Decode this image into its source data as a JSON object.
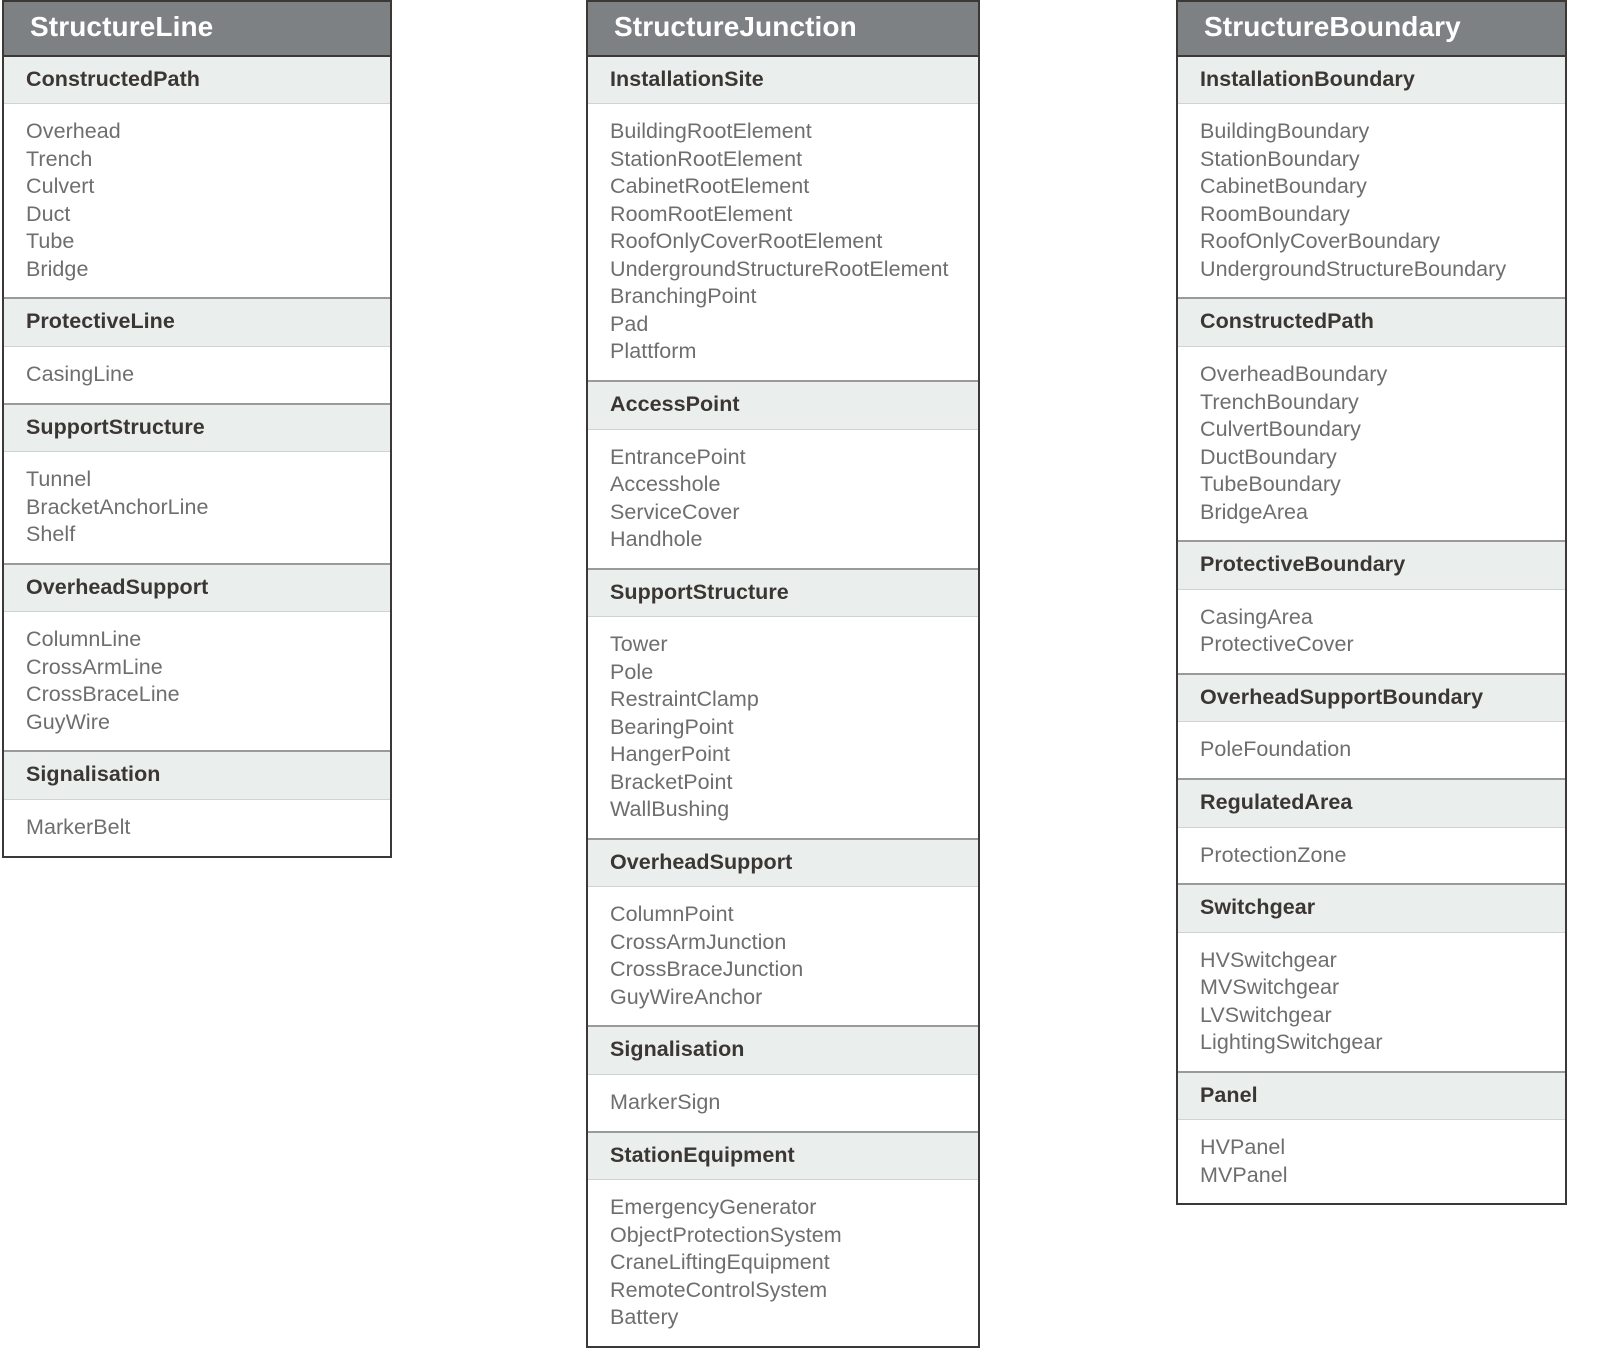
{
  "colors": {
    "title_bar_bg": "#7d8184",
    "title_bar_text": "#ffffff",
    "section_header_bg": "#eaeeed",
    "section_header_text": "#3b3633",
    "item_text": "#6e6e6e",
    "card_border": "#3b3836",
    "section_divider": "#9a9a98",
    "page_bg": "#ffffff"
  },
  "tables": [
    {
      "title": "StructureLine",
      "sections": [
        {
          "name": "ConstructedPath",
          "items": [
            "Overhead",
            "Trench",
            "Culvert",
            "Duct",
            "Tube",
            "Bridge"
          ]
        },
        {
          "name": "ProtectiveLine",
          "items": [
            "CasingLine"
          ]
        },
        {
          "name": "SupportStructure",
          "items": [
            "Tunnel",
            "BracketAnchorLine",
            "Shelf"
          ]
        },
        {
          "name": "OverheadSupport",
          "items": [
            "ColumnLine",
            "CrossArmLine",
            "CrossBraceLine",
            "GuyWire"
          ]
        },
        {
          "name": "Signalisation",
          "items": [
            "MarkerBelt"
          ]
        }
      ]
    },
    {
      "title": "StructureJunction",
      "sections": [
        {
          "name": "InstallationSite",
          "items": [
            "BuildingRootElement",
            "StationRootElement",
            "CabinetRootElement",
            "RoomRootElement",
            "RoofOnlyCoverRootElement",
            "UndergroundStructureRootElement",
            "BranchingPoint",
            "Pad",
            "Plattform"
          ]
        },
        {
          "name": "AccessPoint",
          "items": [
            "EntrancePoint",
            "Accesshole",
            "ServiceCover",
            "Handhole"
          ]
        },
        {
          "name": "SupportStructure",
          "items": [
            "Tower",
            "Pole",
            "RestraintClamp",
            "BearingPoint",
            "HangerPoint",
            "BracketPoint",
            "WallBushing"
          ]
        },
        {
          "name": "OverheadSupport",
          "items": [
            "ColumnPoint",
            "CrossArmJunction",
            "CrossBraceJunction",
            "GuyWireAnchor"
          ]
        },
        {
          "name": "Signalisation",
          "items": [
            "MarkerSign"
          ]
        },
        {
          "name": "StationEquipment",
          "items": [
            "EmergencyGenerator",
            "ObjectProtectionSystem",
            "CraneLiftingEquipment",
            "RemoteControlSystem",
            "Battery"
          ]
        }
      ]
    },
    {
      "title": "StructureBoundary",
      "sections": [
        {
          "name": "InstallationBoundary",
          "items": [
            "BuildingBoundary",
            "StationBoundary",
            "CabinetBoundary",
            "RoomBoundary",
            "RoofOnlyCoverBoundary",
            "UndergroundStructureBoundary"
          ]
        },
        {
          "name": "ConstructedPath",
          "items": [
            "OverheadBoundary",
            "TrenchBoundary",
            "CulvertBoundary",
            "DuctBoundary",
            "TubeBoundary",
            "BridgeArea"
          ]
        },
        {
          "name": "ProtectiveBoundary",
          "items": [
            "CasingArea",
            "ProtectiveCover"
          ]
        },
        {
          "name": "OverheadSupportBoundary",
          "items": [
            "PoleFoundation"
          ]
        },
        {
          "name": "RegulatedArea",
          "items": [
            "ProtectionZone"
          ]
        },
        {
          "name": "Switchgear",
          "items": [
            "HVSwitchgear",
            "MVSwitchgear",
            "LVSwitchgear",
            "LightingSwitchgear"
          ]
        },
        {
          "name": "Panel",
          "items": [
            "HVPanel",
            "MVPanel"
          ]
        }
      ]
    }
  ]
}
